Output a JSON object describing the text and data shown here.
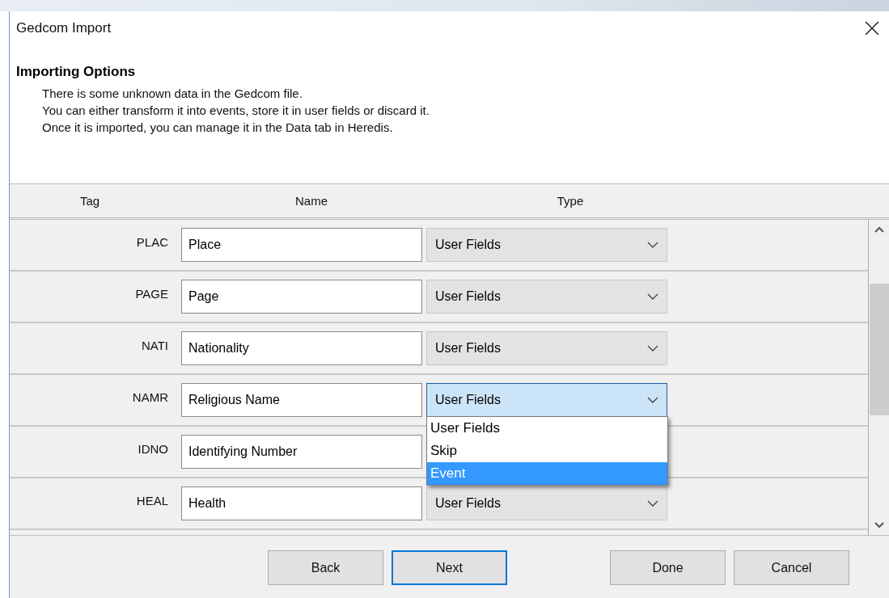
{
  "window": {
    "title": "Gedcom Import"
  },
  "header": {
    "title": "Importing Options",
    "lines": [
      "There is some unknown data in the Gedcom file.",
      "You can either transform it into events, store it in user fields or discard it.",
      "Once it is imported, you can manage it in the Data tab in Heredis."
    ]
  },
  "columns": [
    "Tag",
    "Name",
    "Type"
  ],
  "rows": [
    {
      "tag": "PLAC",
      "name": "Place",
      "type": "User Fields",
      "focused": false
    },
    {
      "tag": "PAGE",
      "name": "Page",
      "type": "User Fields",
      "focused": false
    },
    {
      "tag": "NATI",
      "name": "Nationality",
      "type": "User Fields",
      "focused": false
    },
    {
      "tag": "NAMR",
      "name": "Religious Name",
      "type": "User Fields",
      "focused": true,
      "options": [
        {
          "label": "User Fields",
          "selected": false
        },
        {
          "label": "Skip",
          "selected": false
        },
        {
          "label": "Event",
          "selected": true
        }
      ]
    },
    {
      "tag": "IDNO",
      "name": "Identifying Number"
    },
    {
      "tag": "HEAL",
      "name": "Health",
      "type": "User Fields",
      "focused": false
    }
  ],
  "buttons": [
    {
      "label": "Back",
      "default": false
    },
    {
      "label": "Next",
      "default": true
    },
    {
      "label": "Done",
      "default": false
    },
    {
      "label": "Cancel",
      "default": false
    }
  ]
}
